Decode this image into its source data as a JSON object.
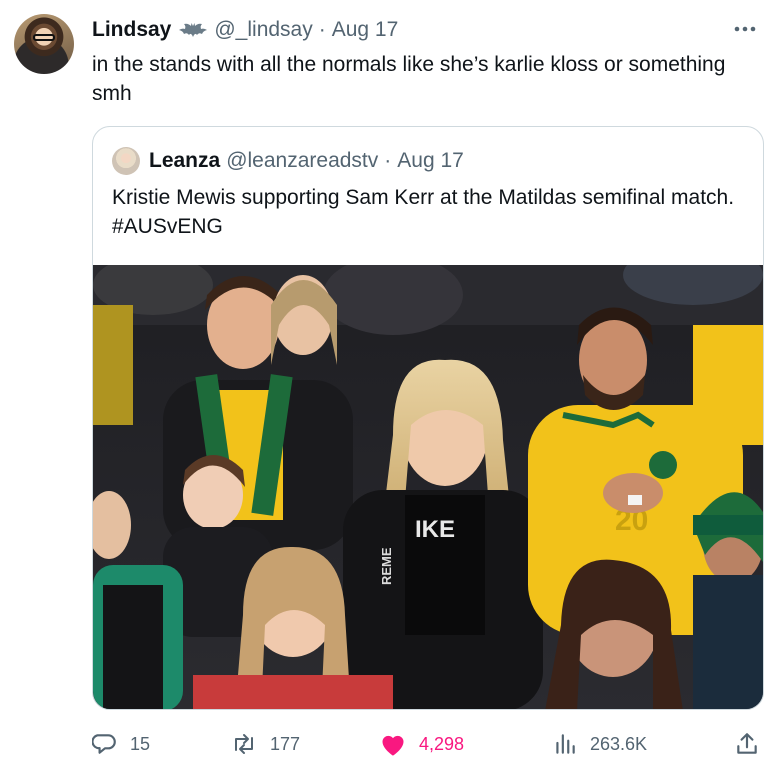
{
  "tweet": {
    "display_name": "Lindsay",
    "handle": "@_lindsay",
    "separator": "·",
    "date": "Aug 17",
    "text": "in the stands with all the normals like she’s karlie kloss or something smh"
  },
  "quoted": {
    "display_name": "Leanza",
    "handle": "@leanzareadstv",
    "separator": "·",
    "date": "Aug 17",
    "text": "Kristie Mewis supporting Sam Kerr at the Matildas semifinal match. #AUSvENG",
    "image": {
      "shirt_text": "REME",
      "logo_text": "IKE",
      "jersey_number": "20"
    }
  },
  "actions": {
    "replies": "15",
    "retweets": "177",
    "likes": "4,298",
    "views": "263.6K"
  },
  "icons": {
    "more": "more-dots-icon",
    "badge": "bat-icon",
    "reply": "reply-icon",
    "retweet": "retweet-icon",
    "like": "heart-icon",
    "views": "views-icon",
    "share": "share-icon"
  },
  "colors": {
    "text": "#0f1419",
    "muted": "#536471",
    "like": "#f91880",
    "border": "#cfd9de",
    "jersey_yellow": "#f2c21a",
    "jersey_green": "#1d6b3a"
  }
}
